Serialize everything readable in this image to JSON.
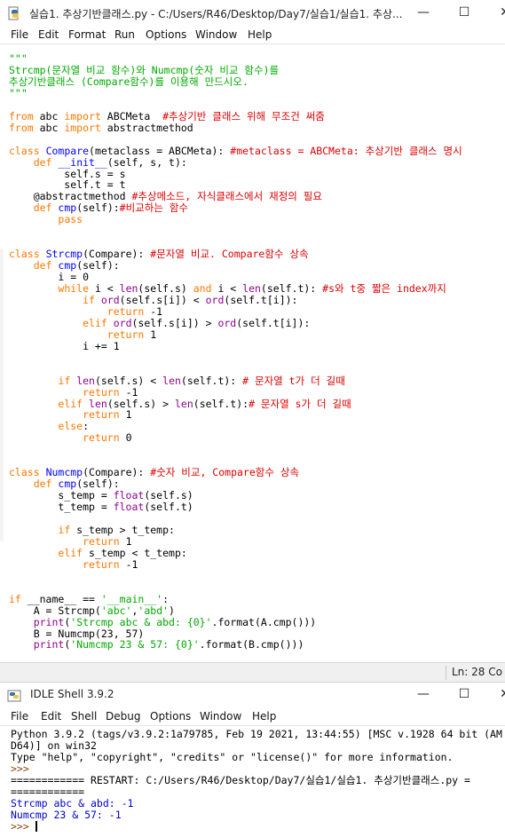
{
  "editor": {
    "title": "실습1. 추상기반클래스.py - C:/Users/R46/Desktop/Day7/실습1/실습1. 추상...",
    "controls": {
      "minimize": "—",
      "maximize": "☐",
      "close": "✕"
    },
    "menu": [
      "File",
      "Edit",
      "Format",
      "Run",
      "Options",
      "Window",
      "Help"
    ],
    "status": "Ln: 28  Co",
    "lines": [
      [
        [
          "s",
          "\"\"\""
        ]
      ],
      [
        [
          "s",
          "Strcmp(문자열 비교 함수)와 Numcmp(숫자 비교 함수)를"
        ]
      ],
      [
        [
          "s",
          "추상기반클래스 (Compare함수)를 이용해 만드시오."
        ]
      ],
      [
        [
          "s",
          "\"\"\""
        ]
      ],
      [],
      [
        [
          "k",
          "from"
        ],
        [
          "n",
          " abc "
        ],
        [
          "k",
          "import"
        ],
        [
          "n",
          " ABCMeta  "
        ],
        [
          "c",
          "#추상기반 클래스 위해 무조건 써줌"
        ]
      ],
      [
        [
          "k",
          "from"
        ],
        [
          "n",
          " abc "
        ],
        [
          "k",
          "import"
        ],
        [
          "n",
          " abstractmethod"
        ]
      ],
      [],
      [
        [
          "k",
          "class"
        ],
        [
          "n",
          " "
        ],
        [
          "d",
          "Compare"
        ],
        [
          "n",
          "(metaclass = ABCMeta): "
        ],
        [
          "c",
          "#metaclass = ABCMeta: 추상기반 클래스 명시"
        ]
      ],
      [
        [
          "n",
          "    "
        ],
        [
          "k",
          "def"
        ],
        [
          "n",
          " "
        ],
        [
          "d",
          "__init__"
        ],
        [
          "n",
          "(self, s, t):"
        ]
      ],
      [
        [
          "n",
          "         self.s = s"
        ]
      ],
      [
        [
          "n",
          "         self.t = t"
        ]
      ],
      [
        [
          "n",
          "    @abstractmethod "
        ],
        [
          "c",
          "#추상메소드, 자식클래스에서 재정의 필요"
        ]
      ],
      [
        [
          "n",
          "    "
        ],
        [
          "k",
          "def"
        ],
        [
          "n",
          " "
        ],
        [
          "d",
          "cmp"
        ],
        [
          "n",
          "(self):"
        ],
        [
          "c",
          "#비교하는 함수"
        ]
      ],
      [
        [
          "n",
          "        "
        ],
        [
          "k",
          "pass"
        ]
      ],
      [],
      [],
      [
        [
          "k",
          "class"
        ],
        [
          "n",
          " "
        ],
        [
          "d",
          "Strcmp"
        ],
        [
          "n",
          "(Compare): "
        ],
        [
          "c",
          "#문자열 비교. Compare함수 상속"
        ]
      ],
      [
        [
          "n",
          "    "
        ],
        [
          "k",
          "def"
        ],
        [
          "n",
          " "
        ],
        [
          "d",
          "cmp"
        ],
        [
          "n",
          "(self):"
        ]
      ],
      [
        [
          "n",
          "        i = 0"
        ]
      ],
      [
        [
          "n",
          "        "
        ],
        [
          "k",
          "while"
        ],
        [
          "n",
          " i < "
        ],
        [
          "b",
          "len"
        ],
        [
          "n",
          "(self.s) "
        ],
        [
          "k",
          "and"
        ],
        [
          "n",
          " i < "
        ],
        [
          "b",
          "len"
        ],
        [
          "n",
          "(self.t): "
        ],
        [
          "c",
          "#s와 t중 짧은 index까지"
        ]
      ],
      [
        [
          "n",
          "            "
        ],
        [
          "k",
          "if"
        ],
        [
          "n",
          " "
        ],
        [
          "b",
          "ord"
        ],
        [
          "n",
          "(self.s[i]) < "
        ],
        [
          "b",
          "ord"
        ],
        [
          "n",
          "(self.t[i]):"
        ]
      ],
      [
        [
          "n",
          "                "
        ],
        [
          "k",
          "return"
        ],
        [
          "n",
          " -1"
        ]
      ],
      [
        [
          "n",
          "            "
        ],
        [
          "k",
          "elif"
        ],
        [
          "n",
          " "
        ],
        [
          "b",
          "ord"
        ],
        [
          "n",
          "(self.s[i]) > "
        ],
        [
          "b",
          "ord"
        ],
        [
          "n",
          "(self.t[i]):"
        ]
      ],
      [
        [
          "n",
          "                "
        ],
        [
          "k",
          "return"
        ],
        [
          "n",
          " 1"
        ]
      ],
      [
        [
          "n",
          "            i += 1"
        ]
      ],
      [],
      [],
      [
        [
          "n",
          "        "
        ],
        [
          "k",
          "if"
        ],
        [
          "n",
          " "
        ],
        [
          "b",
          "len"
        ],
        [
          "n",
          "(self.s) < "
        ],
        [
          "b",
          "len"
        ],
        [
          "n",
          "(self.t): "
        ],
        [
          "c",
          "# 문자열 t가 더 길때"
        ]
      ],
      [
        [
          "n",
          "            "
        ],
        [
          "k",
          "return"
        ],
        [
          "n",
          " -1"
        ]
      ],
      [
        [
          "n",
          "        "
        ],
        [
          "k",
          "elif"
        ],
        [
          "n",
          " "
        ],
        [
          "b",
          "len"
        ],
        [
          "n",
          "(self.s) > "
        ],
        [
          "b",
          "len"
        ],
        [
          "n",
          "(self.t):"
        ],
        [
          "c",
          "# 문자열 s가 더 길때"
        ]
      ],
      [
        [
          "n",
          "            "
        ],
        [
          "k",
          "return"
        ],
        [
          "n",
          " 1"
        ]
      ],
      [
        [
          "n",
          "        "
        ],
        [
          "k",
          "else"
        ],
        [
          "n",
          ":"
        ]
      ],
      [
        [
          "n",
          "            "
        ],
        [
          "k",
          "return"
        ],
        [
          "n",
          " 0"
        ]
      ],
      [],
      [],
      [
        [
          "k",
          "class"
        ],
        [
          "n",
          " "
        ],
        [
          "d",
          "Numcmp"
        ],
        [
          "n",
          "(Compare): "
        ],
        [
          "c",
          "#숫자 비교, Compare함수 상속"
        ]
      ],
      [
        [
          "n",
          "    "
        ],
        [
          "k",
          "def"
        ],
        [
          "n",
          " "
        ],
        [
          "d",
          "cmp"
        ],
        [
          "n",
          "(self):"
        ]
      ],
      [
        [
          "n",
          "        s_temp = "
        ],
        [
          "b",
          "float"
        ],
        [
          "n",
          "(self.s)"
        ]
      ],
      [
        [
          "n",
          "        t_temp = "
        ],
        [
          "b",
          "float"
        ],
        [
          "n",
          "(self.t)"
        ]
      ],
      [],
      [
        [
          "n",
          "        "
        ],
        [
          "k",
          "if"
        ],
        [
          "n",
          " s_temp > t_temp:"
        ]
      ],
      [
        [
          "n",
          "            "
        ],
        [
          "k",
          "return"
        ],
        [
          "n",
          " 1"
        ]
      ],
      [
        [
          "n",
          "        "
        ],
        [
          "k",
          "elif"
        ],
        [
          "n",
          " s_temp < t_temp:"
        ]
      ],
      [
        [
          "n",
          "            "
        ],
        [
          "k",
          "return"
        ],
        [
          "n",
          " -1"
        ]
      ],
      [],
      [],
      [
        [
          "k",
          "if"
        ],
        [
          "n",
          " __name__ == "
        ],
        [
          "s",
          "'__main__'"
        ],
        [
          "n",
          ":"
        ]
      ],
      [
        [
          "n",
          "    A = Strcmp("
        ],
        [
          "s",
          "'abc'"
        ],
        [
          "n",
          ","
        ],
        [
          "s",
          "'abd'"
        ],
        [
          "n",
          ")"
        ]
      ],
      [
        [
          "n",
          "    "
        ],
        [
          "b",
          "print"
        ],
        [
          "n",
          "("
        ],
        [
          "s",
          "'Strcmp abc & abd: {0}'"
        ],
        [
          "n",
          ".format(A.cmp()))"
        ]
      ],
      [
        [
          "n",
          "    B = Numcmp(23, 57)"
        ]
      ],
      [
        [
          "n",
          "    "
        ],
        [
          "b",
          "print"
        ],
        [
          "n",
          "("
        ],
        [
          "s",
          "'Numcmp 23 & 57: {0}'"
        ],
        [
          "n",
          ".format(B.cmp()))"
        ]
      ]
    ]
  },
  "shell": {
    "title": "IDLE Shell 3.9.2",
    "controls": {
      "minimize": "—",
      "maximize": "☐",
      "close": "✕"
    },
    "menu": [
      "File",
      "Edit",
      "Shell",
      "Debug",
      "Options",
      "Window",
      "Help"
    ],
    "output": [
      {
        "style": "normal",
        "text": "Python 3.9.2 (tags/v3.9.2:1a79785, Feb 19 2021, 13:44:55) [MSC v.1928 64 bit (AM"
      },
      {
        "style": "normal",
        "text": "D64)] on win32"
      },
      {
        "style": "normal",
        "text": "Type \"help\", \"copyright\", \"credits\" or \"license()\" for more information."
      },
      {
        "style": "prompt",
        "text": ">>> "
      },
      {
        "style": "normal",
        "text": "============ RESTART: C:/Users/R46/Desktop/Day7/실습1/실습1. 추상기반클래스.py ="
      },
      {
        "style": "normal",
        "text": "============"
      },
      {
        "style": "blue",
        "text": "Strcmp abc & abd: -1"
      },
      {
        "style": "blue",
        "text": "Numcmp 23 & 57: -1"
      },
      {
        "style": "prompt",
        "text": ">>> "
      }
    ]
  }
}
